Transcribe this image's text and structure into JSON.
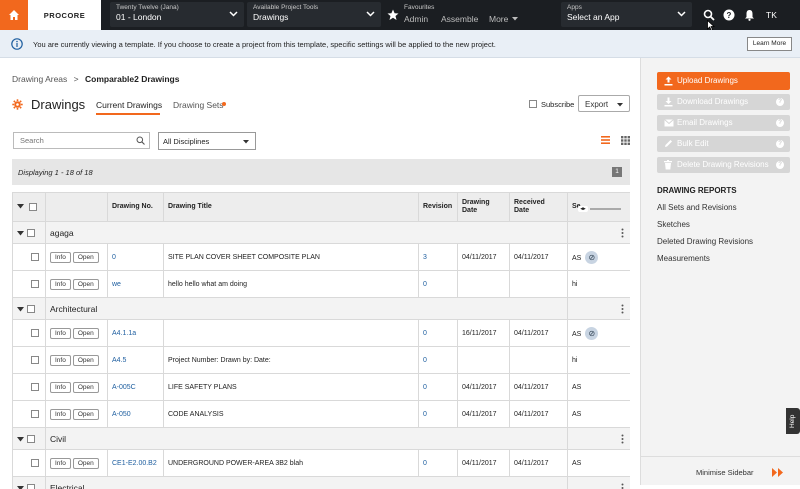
{
  "topbar": {
    "logo": "PROCORE",
    "project": {
      "sub": "Twenty Twelve (Jana)",
      "value": "01 - London"
    },
    "tools": {
      "sub": "Available Project Tools",
      "value": "Drawings"
    },
    "favourites": {
      "label": "Favourites",
      "items": [
        "Admin",
        "Assemble"
      ],
      "more": "More"
    },
    "apps": {
      "sub": "Apps",
      "value": "Select an App"
    },
    "avatar": "TK"
  },
  "banner": {
    "text": "You are currently viewing a template. If you choose to create a project from this template, specific settings will be applied to the new project.",
    "button": "Learn More"
  },
  "breadcrumb": {
    "parent": "Drawing Areas",
    "sep": ">",
    "current": "Comparable2 Drawings"
  },
  "page": {
    "title": "Drawings",
    "tabs": [
      "Current Drawings",
      "Drawing Sets"
    ],
    "subscribe": "Subscribe",
    "export": "Export"
  },
  "filters": {
    "search_placeholder": "Search",
    "discipline": "All Disciplines"
  },
  "table": {
    "displaying": "Displaying 1 - 18 of 18",
    "page": "1",
    "headers": {
      "no": "Drawing No.",
      "title": "Drawing Title",
      "rev": "Revision",
      "ddate1": "Drawing",
      "ddate2": "Date",
      "rdate1": "Received",
      "rdate2": "Date",
      "set": "Se"
    },
    "info_label": "Info",
    "open_label": "Open",
    "groups": [
      {
        "name": "agaga",
        "rows": [
          {
            "no": "0",
            "title": "SITE PLAN COVER SHEET COMPOSITE PLAN",
            "rev": "3",
            "ddate": "04/11/2017",
            "rdate": "04/11/2017",
            "set": "AS",
            "clip": true
          },
          {
            "no": "we",
            "title": "hello hello what am doing",
            "rev": "0",
            "ddate": "",
            "rdate": "",
            "set": "hi",
            "clip": false
          }
        ]
      },
      {
        "name": "Architectural",
        "rows": [
          {
            "no": "A4.1.1a",
            "title": "",
            "rev": "0",
            "ddate": "16/11/2017",
            "rdate": "04/11/2017",
            "set": "AS",
            "clip": true
          },
          {
            "no": "A4.5",
            "title": "Project Number: Drawn by: Date:",
            "rev": "0",
            "ddate": "",
            "rdate": "",
            "set": "hi",
            "clip": false
          },
          {
            "no": "A-005C",
            "title": "LIFE SAFETY PLANS",
            "rev": "0",
            "ddate": "04/11/2017",
            "rdate": "04/11/2017",
            "set": "AS",
            "clip": false
          },
          {
            "no": "A-050",
            "title": "CODE ANALYSIS",
            "rev": "0",
            "ddate": "04/11/2017",
            "rdate": "04/11/2017",
            "set": "AS",
            "clip": false
          }
        ]
      },
      {
        "name": "Civil",
        "rows": [
          {
            "no": "CE1-E2.00.B2",
            "title": "UNDERGROUND POWER-AREA 3B2 blah",
            "rev": "0",
            "ddate": "04/11/2017",
            "rdate": "04/11/2017",
            "set": "AS",
            "clip": false
          }
        ]
      },
      {
        "name": "Electrical",
        "rows": []
      }
    ]
  },
  "sidebar": {
    "upload": "Upload Drawings",
    "download": "Download Drawings",
    "email": "Email Drawings",
    "bulk": "Bulk Edit",
    "delete": "Delete Drawing Revisions",
    "reports_title": "DRAWING REPORTS",
    "reports": [
      "All Sets and Revisions",
      "Sketches",
      "Deleted Drawing Revisions",
      "Measurements"
    ],
    "minimise": "Minimise Sidebar"
  },
  "help": "Help",
  "colors": {
    "brand": "#f2681d",
    "link": "#1f5fa0",
    "topbar": "#1b1e22"
  }
}
